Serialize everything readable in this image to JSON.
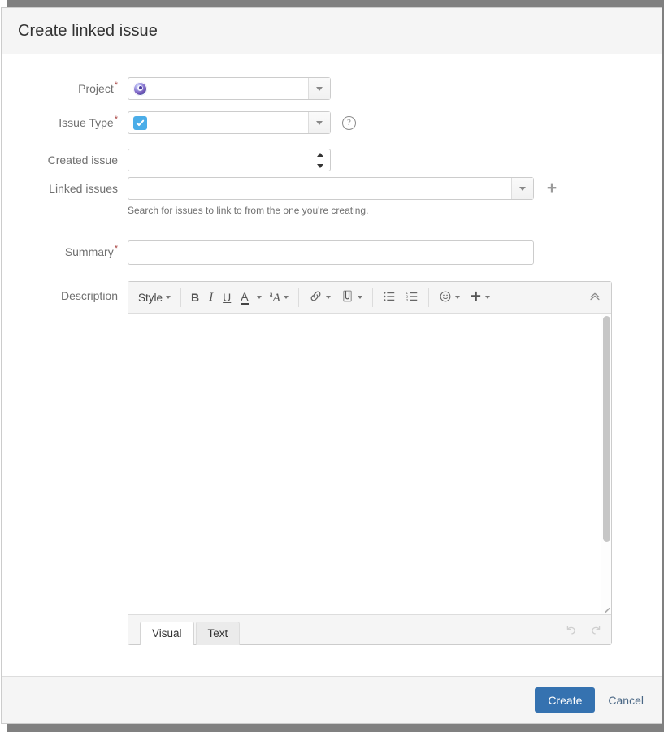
{
  "dialog": {
    "title": "Create linked issue",
    "fields": {
      "project": {
        "label": "Project",
        "required": true,
        "value": "",
        "icon": "project-avatar-icon"
      },
      "issue_type": {
        "label": "Issue Type",
        "required": true,
        "value": "",
        "icon": "task-icon",
        "help_icon": "?"
      },
      "created_issue": {
        "label": "Created issue",
        "required": false,
        "value": ""
      },
      "linked_issues": {
        "label": "Linked issues",
        "required": false,
        "value": "",
        "help_text": "Search for issues to link to from the one you're creating.",
        "add_label": "+"
      },
      "summary": {
        "label": "Summary",
        "required": true,
        "value": "",
        "placeholder": ""
      },
      "description": {
        "label": "Description",
        "required": false,
        "value": ""
      }
    },
    "editor": {
      "toolbar": {
        "style_label": "Style",
        "bold_label": "B",
        "italic_label": "I",
        "underline_label": "U",
        "color_label": "A",
        "font_effects_label": "A",
        "font_effects_sup": "a",
        "link_icon": "link-icon",
        "attachment_icon": "paperclip-icon",
        "bullet_list_icon": "bullet-list-icon",
        "numbered_list_icon": "numbered-list-icon",
        "emoji_icon": "smiley-icon",
        "insert_icon": "plus-icon",
        "collapse_icon": "chevron-double-up-icon"
      },
      "tabs": [
        {
          "label": "Visual",
          "active": true
        },
        {
          "label": "Text",
          "active": false
        }
      ],
      "undo_icon": "undo-icon",
      "redo_icon": "redo-icon",
      "content": ""
    },
    "footer": {
      "create_label": "Create",
      "cancel_label": "Cancel"
    }
  },
  "colors": {
    "primary_button": "#3572b0",
    "cancel_link": "#4a6785",
    "required_asterisk": "#a94442",
    "issue_type_icon": "#4bade8",
    "page_background": "#808080",
    "panel_background": "#f5f5f5"
  }
}
